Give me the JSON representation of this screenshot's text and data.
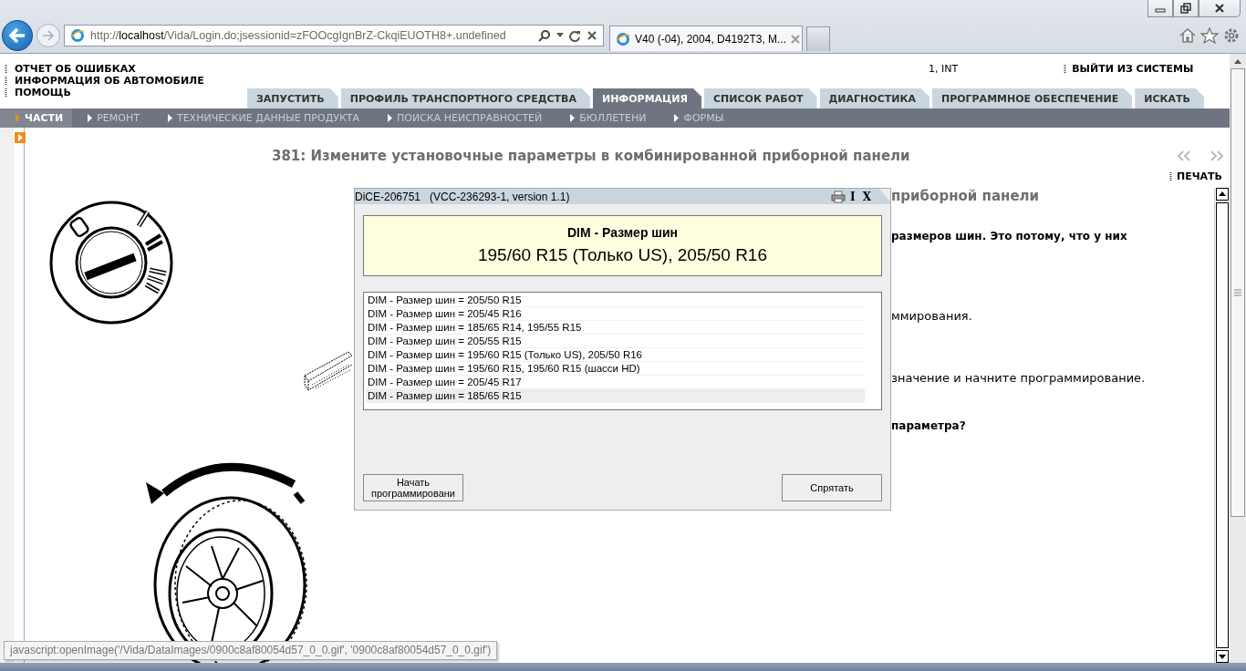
{
  "browser": {
    "address": "http://**localhost**/Vida/Login.do;jsessionid=zFOOcgIgnBrZ-CkqiEUOTH8+.undefined",
    "tab_title": "V40 (-04), 2004, D4192T3, M..."
  },
  "header": {
    "links": [
      "ОТЧЕТ ОБ ОШИБКАХ",
      "ИНФОРМАЦИЯ ОБ АВТОМОБИЛЕ",
      "ПОМОЩЬ"
    ],
    "user": "1, INT",
    "logout": "ВЫЙТИ ИЗ СИСТЕМЫ"
  },
  "tabs": [
    {
      "label": "ЗАПУСТИТЬ",
      "selected": false
    },
    {
      "label": "ПРОФИЛЬ ТРАНСПОРТНОГО СРЕДСТВА",
      "selected": false
    },
    {
      "label": "ИНФОРМАЦИЯ",
      "selected": true
    },
    {
      "label": "СПИСОК РАБОТ",
      "selected": false
    },
    {
      "label": "ДИАГНОСТИКА",
      "selected": false
    },
    {
      "label": "ПРОГРАММНОЕ ОБЕСПЕЧЕНИЕ",
      "selected": false
    },
    {
      "label": "ИСКАТЬ",
      "selected": false
    }
  ],
  "subnav": [
    {
      "label": "ЧАСТИ",
      "selected": true
    },
    {
      "label": "РЕМОНТ",
      "selected": false
    },
    {
      "label": "ТЕХНИЧЕСКИЕ ДАННЫЕ ПРОДУКТА",
      "selected": false
    },
    {
      "label": "ПОИСКА НЕИСПРАВНОСТЕЙ",
      "selected": false
    },
    {
      "label": "БЮЛЛЕТЕНИ",
      "selected": false
    },
    {
      "label": "ФОРМЫ",
      "selected": false
    }
  ],
  "document": {
    "title": "381: Измените установочные параметры в комбинированной приборной панели",
    "print": "ПЕЧАТЬ",
    "heading": "приборной панели",
    "paragraphs": [
      {
        "text": "размеров шин. Это потому, что у них",
        "bold": true
      },
      {
        "text": "ммирования.",
        "bold": false
      },
      {
        "text": "значение и начните программирование.",
        "bold": false
      },
      {
        "text": "параметра?",
        "bold": true
      }
    ]
  },
  "dialog": {
    "title": "DiCE-206751   (VCC-236293-1, version 1.1)",
    "info": "I",
    "close": "X",
    "parameter": "DIM - Размер шин",
    "value": "195/60 R15 (Только US), 205/50 R16",
    "options": [
      {
        "text": "DIM - Размер шин = 205/50 R15",
        "selected": false
      },
      {
        "text": "DIM - Размер шин = 205/45 R16",
        "selected": false
      },
      {
        "text": "DIM - Размер шин = 185/65 R14, 195/55 R15",
        "selected": false
      },
      {
        "text": "DIM - Размер шин = 205/55 R15",
        "selected": false
      },
      {
        "text": "DIM - Размер шин = 195/60 R15 (Только US), 205/50 R16",
        "selected": false
      },
      {
        "text": "DIM - Размер шин = 195/60 R15, 195/60 R15 (шасси HD)",
        "selected": false
      },
      {
        "text": "DIM - Размер шин = 205/45 R17",
        "selected": false
      },
      {
        "text": "DIM - Размер шин = 185/65 R15",
        "selected": true
      }
    ],
    "buttons": [
      "Начать программировани",
      "Спрятать"
    ]
  },
  "status_text": "javascript:openImage('/Vida/DataImages/0900c8af80054d57_0_0.gif', '0900c8af80054d57_0_0.gif')"
}
